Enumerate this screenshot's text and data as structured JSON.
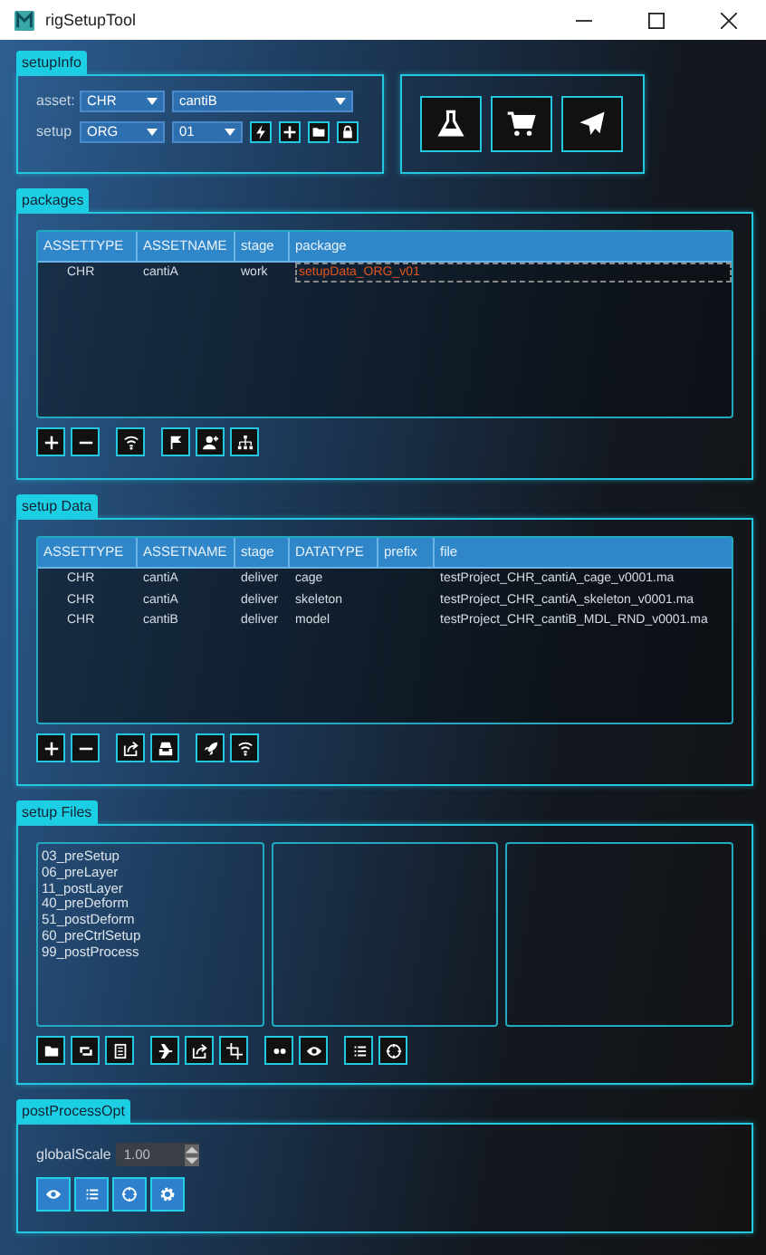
{
  "window": {
    "title": "rigSetupTool"
  },
  "setup_info": {
    "tab": "setupInfo",
    "asset_label": "asset:",
    "asset_type": "CHR",
    "asset_name": "cantiB",
    "setup_label": "setup",
    "setup_type": "ORG",
    "setup_version": "01"
  },
  "packages": {
    "tab": "packages",
    "columns": [
      "ASSETTYPE",
      "ASSETNAME",
      "stage",
      "package"
    ],
    "rows": [
      {
        "cells": [
          "CHR",
          "cantiA",
          "work",
          "setupData_ORG_v01"
        ],
        "highlight": true
      }
    ]
  },
  "setup_data": {
    "tab": "setup Data",
    "columns": [
      "ASSETTYPE",
      "ASSETNAME",
      "stage",
      "DATATYPE",
      "prefix",
      "file"
    ],
    "rows": [
      {
        "cells": [
          "CHR",
          "cantiA",
          "deliver",
          "cage",
          "",
          "testProject_CHR_cantiA_cage_v0001.ma"
        ]
      },
      {
        "cells": [
          "CHR",
          "cantiA",
          "deliver",
          "skeleton",
          "",
          "testProject_CHR_cantiA_skeleton_v0001.ma"
        ]
      },
      {
        "cells": [
          "CHR",
          "cantiB",
          "deliver",
          "model",
          "",
          "testProject_CHR_cantiB_MDL_RND_v0001.ma"
        ]
      }
    ]
  },
  "setup_files": {
    "tab": "setup Files",
    "files": [
      "03_preSetup",
      "06_preLayer",
      "11_postLayer",
      "40_preDeform",
      "51_postDeform",
      "60_preCtrlSetup",
      "99_postProcess"
    ]
  },
  "post_process": {
    "tab": "postProcessOpt",
    "global_scale_label": "globalScale",
    "global_scale": "1.00"
  }
}
